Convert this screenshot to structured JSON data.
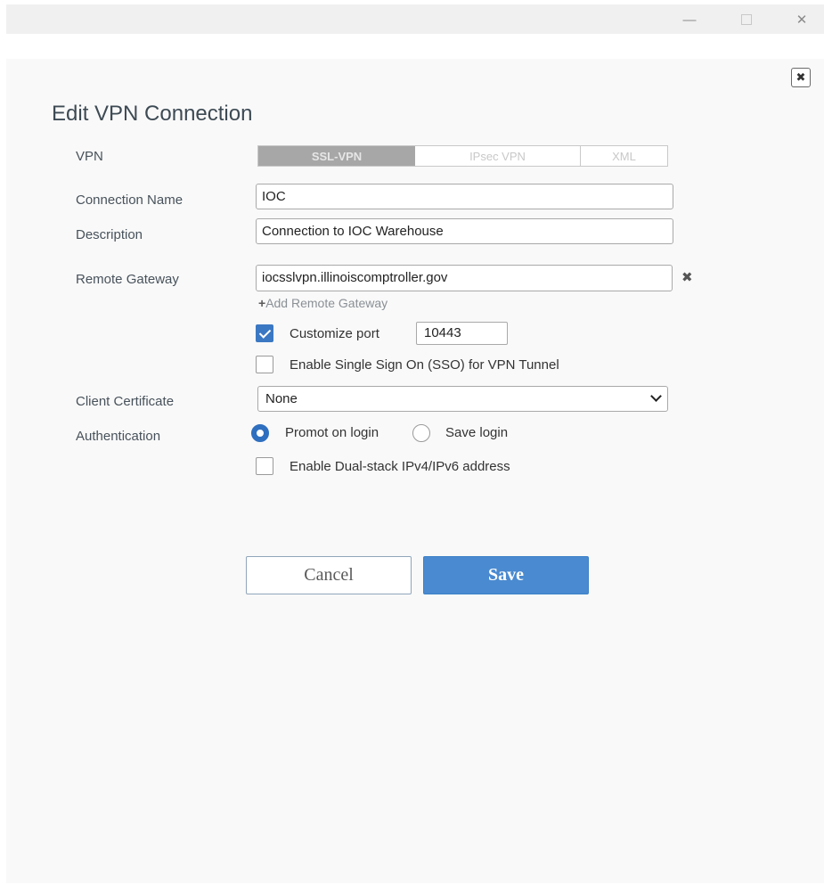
{
  "window": {
    "minimize_glyph": "—",
    "close_glyph": "✕"
  },
  "dialog": {
    "title": "Edit VPN Connection",
    "close_glyph": "✖"
  },
  "vpn": {
    "label": "VPN",
    "tabs": [
      "SSL-VPN",
      "IPsec VPN",
      "XML"
    ],
    "selected": "SSL-VPN"
  },
  "connection_name": {
    "label": "Connection Name",
    "value": "IOC"
  },
  "description": {
    "label": "Description",
    "value": "Connection to IOC Warehouse"
  },
  "remote_gateway": {
    "label": "Remote Gateway",
    "value": "iocsslvpn.illinoiscomptroller.gov",
    "remove_glyph": "✖",
    "add_label": "Add Remote Gateway"
  },
  "customize_port": {
    "label": "Customize port",
    "checked": true,
    "value": "10443"
  },
  "sso": {
    "label": "Enable Single Sign On (SSO) for VPN Tunnel",
    "checked": false
  },
  "client_certificate": {
    "label": "Client Certificate",
    "value": "None"
  },
  "authentication": {
    "label": "Authentication",
    "options": [
      "Promot on login",
      "Save login"
    ],
    "selected": "Promot on login"
  },
  "dual_stack": {
    "label": "Enable Dual-stack IPv4/IPv6 address",
    "checked": false
  },
  "buttons": {
    "cancel": "Cancel",
    "save": "Save"
  },
  "colors": {
    "accent": "#4a8ad0",
    "checkbox": "#3b78c3"
  }
}
